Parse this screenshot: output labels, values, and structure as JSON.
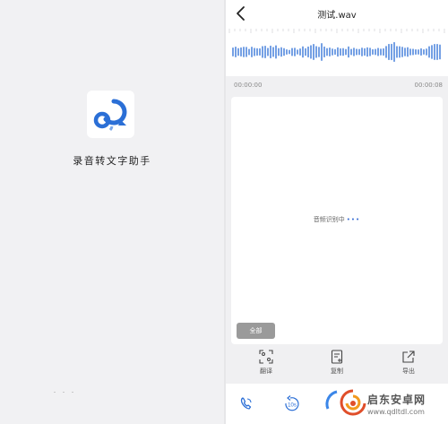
{
  "splash": {
    "app_name": "录音转文字助手",
    "logo_icon": "speech-bubble-logo-icon",
    "logo_color": "#2b6fd6"
  },
  "topbar": {
    "back_icon": "chevron-left-icon",
    "title": "测试.wav"
  },
  "waveform": {
    "color": "#3a78d8"
  },
  "timeline": {
    "start": "00:00:00",
    "end": "00:00:08"
  },
  "transcript": {
    "status": "音频识别中",
    "status_dots": "•••",
    "all_button": "全部"
  },
  "toolbar": {
    "items": [
      {
        "icon": "scan-translate-icon",
        "label": "翻译"
      },
      {
        "icon": "copy-document-icon",
        "label": "复制"
      },
      {
        "icon": "export-icon",
        "label": "导出"
      }
    ]
  },
  "player": {
    "controls": [
      {
        "icon": "phone-icon"
      },
      {
        "icon": "rewind-10s-icon",
        "label": "10s"
      },
      {
        "icon": "play-icon"
      }
    ]
  },
  "watermark": {
    "text": "启东安卓网",
    "url": "www.qdltdl.com"
  }
}
